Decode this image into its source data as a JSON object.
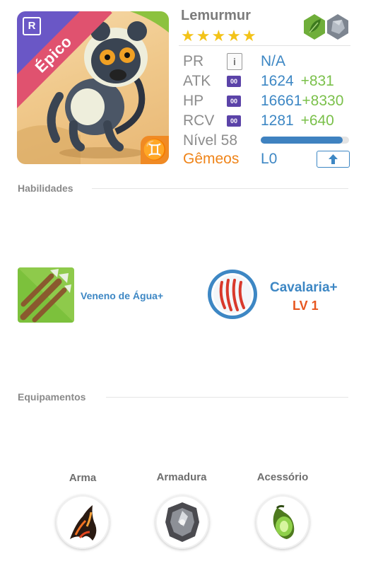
{
  "monster": {
    "name": "Lemurmur",
    "stars": "★★★★★",
    "rarity": "Épico",
    "rarity_badge": "R",
    "zodiac_symbol": "♊",
    "elements": [
      "leaf-icon",
      "rock-icon"
    ]
  },
  "stats": {
    "pr": {
      "label": "PR",
      "value": "N/A"
    },
    "atk": {
      "label": "ATK",
      "value": "1624",
      "plus": "+831",
      "icon_text": "00"
    },
    "hp": {
      "label": "HP",
      "value": "16661",
      "plus": "+8330",
      "icon_text": "00"
    },
    "rcv": {
      "label": "RCV",
      "value": "1281",
      "plus": "+640",
      "icon_text": "00"
    },
    "level": {
      "label": "Nível 58",
      "progress": 0.93
    },
    "awaken": {
      "label": "Gêmeos",
      "value": "L0"
    }
  },
  "sections": {
    "skills": "Habilidades",
    "equipment": "Equipamentos"
  },
  "skills": {
    "active": {
      "name": "Veneno de Água+"
    },
    "leader": {
      "name": "Cavalaria+",
      "level": "LV 1"
    }
  },
  "equipment": {
    "weapon": {
      "label": "Arma"
    },
    "armor": {
      "label": "Armadura"
    },
    "accessory": {
      "label": "Acessório"
    }
  },
  "colors": {
    "accent_blue": "#3d87c4",
    "bonus_green": "#7ac04a",
    "gemini_orange": "#ef8419",
    "rarity_pink": "#e0526f",
    "rarity_purple": "#6a57c6",
    "leader_level_red": "#e7561f"
  }
}
